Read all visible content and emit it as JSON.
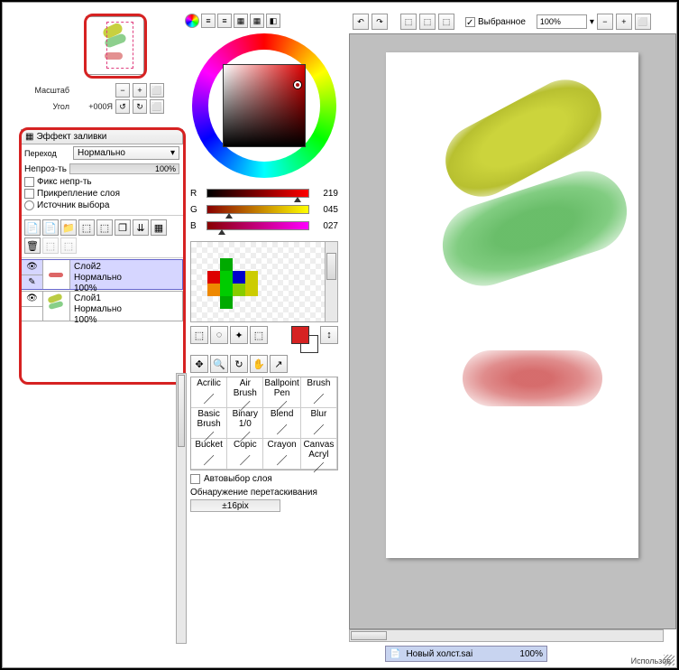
{
  "nav": {
    "zoom_label": "Масштаб",
    "angle_label": "Угол",
    "angle_value": "+000Я"
  },
  "fill": {
    "title": "Эффект заливки",
    "transition_label": "Переход",
    "transition_value": "Нормально",
    "opacity_label": "Непроз-ть",
    "opacity_value": "100%",
    "fix_opacity": "Фикс непр-ть",
    "clip_layer": "Прикрепление слоя",
    "sel_source": "Источник выбора"
  },
  "layers": [
    {
      "name": "Слой2",
      "mode": "Нормально",
      "opacity": "100%",
      "selected": true,
      "stroke": "red"
    },
    {
      "name": "Слой1",
      "mode": "Нормально",
      "opacity": "100%",
      "selected": false,
      "stroke": "mix"
    }
  ],
  "rgb": {
    "r": {
      "ch": "R",
      "val": "219",
      "pct": 86,
      "grad": "linear-gradient(to right,#000,#f00)"
    },
    "g": {
      "ch": "G",
      "val": "045",
      "pct": 18,
      "grad": "linear-gradient(to right,#800,#ff0)"
    },
    "b": {
      "ch": "B",
      "val": "027",
      "pct": 11,
      "grad": "linear-gradient(to right,#800,#f0f)"
    }
  },
  "swatches": [
    "",
    "#0a0",
    "",
    "",
    "",
    "#d00",
    "#0c0",
    "#00c",
    "#cc0",
    "",
    "#e80",
    "#0c0",
    "#8c0",
    "#cc0",
    "",
    "",
    "#0a0",
    "",
    "",
    ""
  ],
  "brushes": [
    "Acrilic",
    "Air Brush",
    "Ballpoint Pen",
    "Brush",
    "Basic Brush",
    "Binary 1/0",
    "Blend",
    "Blur",
    "Bucket",
    "Copic",
    "Crayon",
    "Canvas Acryl"
  ],
  "auto_select": "Автовыбор слоя",
  "drag_detect": "Обнаружение перетаскивания",
  "drag_value": "±16pix",
  "canvas_tb": {
    "selected": "Выбранное",
    "zoom": "100%"
  },
  "file": {
    "name": "Новый холст.sai",
    "zoom": "100%"
  },
  "status": "Использов"
}
